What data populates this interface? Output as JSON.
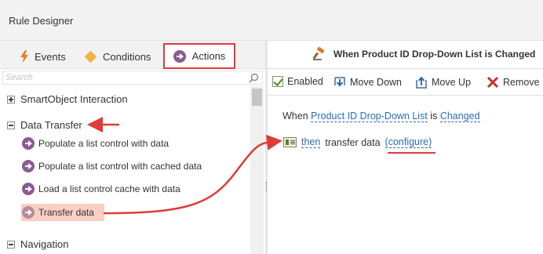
{
  "app": {
    "title": "Rule Designer"
  },
  "tabs": [
    {
      "label": "Events",
      "icon": "lightning-bolt-icon"
    },
    {
      "label": "Conditions",
      "icon": "diamond-icon"
    },
    {
      "label": "Actions",
      "icon": "action-arrow-icon",
      "active": true
    }
  ],
  "search": {
    "placeholder": "Search"
  },
  "tree": {
    "groups": [
      {
        "label": "SmartObject Interaction",
        "expanded": false
      },
      {
        "label": "Data Transfer",
        "expanded": true
      },
      {
        "label": "Navigation",
        "expanded": true
      }
    ],
    "items": [
      {
        "label": "Populate a list control with data"
      },
      {
        "label": "Populate a list control with cached data"
      },
      {
        "label": "Load a list control cache with data"
      },
      {
        "label": "Transfer data",
        "highlighted": true
      }
    ]
  },
  "rule": {
    "header": "When Product ID Drop-Down List is Changed",
    "toolbar": {
      "enabled_label": "Enabled",
      "move_down_label": "Move Down",
      "move_up_label": "Move Up",
      "remove_label": "Remove"
    },
    "line1": {
      "prefix": "When",
      "control": "Product ID Drop-Down List",
      "mid": "is",
      "event": "Changed"
    },
    "line2": {
      "then": "then",
      "text": "transfer data",
      "configure": "(configure)"
    }
  },
  "colors": {
    "highlight_red": "#e03a3a",
    "link_blue": "#2b6cb0",
    "action_purple": "#8a5b92",
    "selected_item_bg": "#f9cfc4"
  }
}
